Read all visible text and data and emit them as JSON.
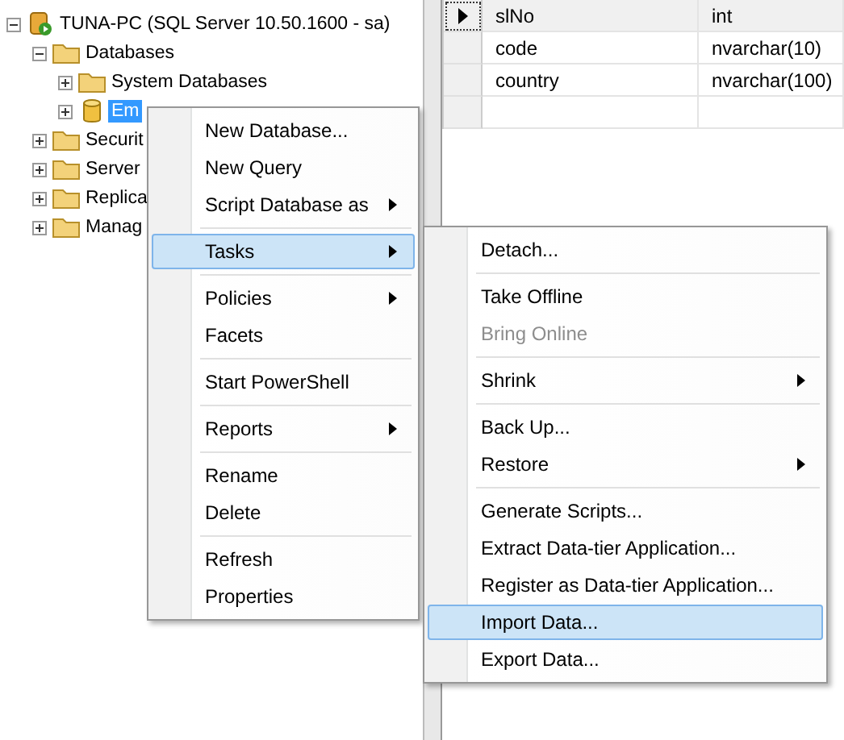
{
  "object_explorer": {
    "tree": [
      {
        "label": "TUNA-PC (SQL Server 10.50.1600 - sa)",
        "kind": "server",
        "expanded": true,
        "selected": false,
        "children": [
          {
            "label": "Databases",
            "kind": "folder",
            "expanded": true,
            "selected": false,
            "children": [
              {
                "label": "System Databases",
                "kind": "folder",
                "expanded": false,
                "selected": false
              },
              {
                "label": "Em",
                "kind": "database",
                "expanded": false,
                "selected": true
              }
            ]
          },
          {
            "label": "Securit",
            "kind": "folder",
            "expanded": false,
            "selected": false
          },
          {
            "label": "Server",
            "kind": "folder",
            "expanded": false,
            "selected": false
          },
          {
            "label": "Replica",
            "kind": "folder",
            "expanded": false,
            "selected": false
          },
          {
            "label": "Manag",
            "kind": "folder",
            "expanded": false,
            "selected": false
          }
        ]
      }
    ]
  },
  "table": {
    "rows": [
      {
        "cells": [
          "slNo",
          "int"
        ],
        "selected": true
      },
      {
        "cells": [
          "code",
          "nvarchar(10)"
        ],
        "selected": false
      },
      {
        "cells": [
          "country",
          "nvarchar(100)"
        ],
        "selected": false
      }
    ]
  },
  "context_menu": {
    "items": [
      {
        "kind": "item",
        "label": "New Database...",
        "submenu": false,
        "selected": false
      },
      {
        "kind": "item",
        "label": "New Query",
        "submenu": false,
        "selected": false
      },
      {
        "kind": "item",
        "label": "Script Database as",
        "submenu": true,
        "selected": false
      },
      {
        "kind": "separator"
      },
      {
        "kind": "item",
        "label": "Tasks",
        "submenu": true,
        "selected": true
      },
      {
        "kind": "separator"
      },
      {
        "kind": "item",
        "label": "Policies",
        "submenu": true,
        "selected": false
      },
      {
        "kind": "item",
        "label": "Facets",
        "submenu": false,
        "selected": false
      },
      {
        "kind": "separator"
      },
      {
        "kind": "item",
        "label": "Start PowerShell",
        "submenu": false,
        "selected": false
      },
      {
        "kind": "separator"
      },
      {
        "kind": "item",
        "label": "Reports",
        "submenu": true,
        "selected": false
      },
      {
        "kind": "separator"
      },
      {
        "kind": "item",
        "label": "Rename",
        "submenu": false,
        "selected": false
      },
      {
        "kind": "item",
        "label": "Delete",
        "submenu": false,
        "selected": false
      },
      {
        "kind": "separator"
      },
      {
        "kind": "item",
        "label": "Refresh",
        "submenu": false,
        "selected": false
      },
      {
        "kind": "item",
        "label": "Properties",
        "submenu": false,
        "selected": false
      }
    ]
  },
  "tasks_submenu": {
    "items": [
      {
        "kind": "item",
        "label": "Detach...",
        "submenu": false,
        "selected": false,
        "disabled": false
      },
      {
        "kind": "separator"
      },
      {
        "kind": "item",
        "label": "Take Offline",
        "submenu": false,
        "selected": false,
        "disabled": false
      },
      {
        "kind": "item",
        "label": "Bring Online",
        "submenu": false,
        "selected": false,
        "disabled": true
      },
      {
        "kind": "separator"
      },
      {
        "kind": "item",
        "label": "Shrink",
        "submenu": true,
        "selected": false,
        "disabled": false
      },
      {
        "kind": "separator"
      },
      {
        "kind": "item",
        "label": "Back Up...",
        "submenu": false,
        "selected": false,
        "disabled": false
      },
      {
        "kind": "item",
        "label": "Restore",
        "submenu": true,
        "selected": false,
        "disabled": false
      },
      {
        "kind": "separator"
      },
      {
        "kind": "item",
        "label": "Generate Scripts...",
        "submenu": false,
        "selected": false,
        "disabled": false
      },
      {
        "kind": "item",
        "label": "Extract Data-tier Application...",
        "submenu": false,
        "selected": false,
        "disabled": false
      },
      {
        "kind": "item",
        "label": "Register as Data-tier Application...",
        "submenu": false,
        "selected": false,
        "disabled": false
      },
      {
        "kind": "item",
        "label": "Import Data...",
        "submenu": false,
        "selected": true,
        "disabled": false
      },
      {
        "kind": "item",
        "label": "Export Data...",
        "submenu": false,
        "selected": false,
        "disabled": false
      }
    ]
  }
}
